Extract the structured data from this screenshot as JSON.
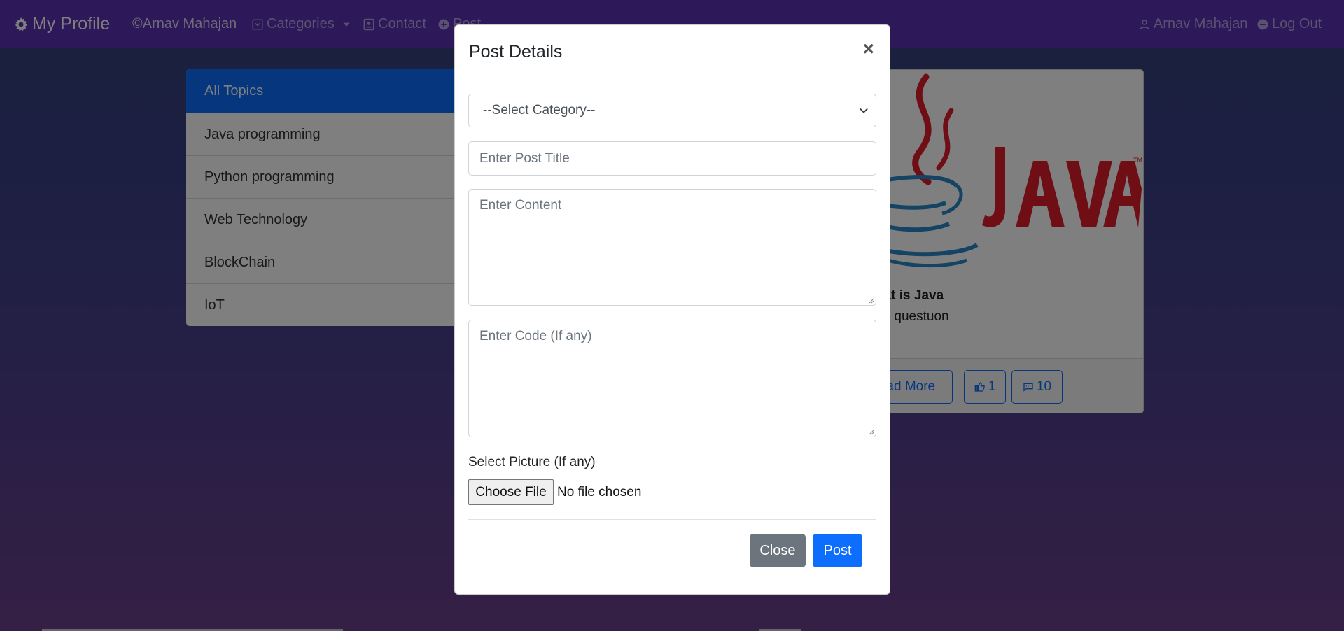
{
  "navbar": {
    "brand": "My Profile",
    "user_link": "©Arnav Mahajan",
    "categories": "Categories",
    "contact": "Contact",
    "post": "Post",
    "profile": "Arnav Mahajan",
    "logout": "Log Out",
    "bg_color": "#5a30b5"
  },
  "categories": [
    "All Topics",
    "Java programming",
    "Python programming",
    "Web Technology",
    "BlockChain",
    "IoT"
  ],
  "post_card": {
    "title": "hat is Java",
    "text": "ob questuon",
    "read_more": "ead More",
    "likes": "1",
    "comments": "10"
  },
  "modal": {
    "title": "Post Details",
    "close_symbol": "×",
    "category_select": "--Select Category--",
    "title_placeholder": "Enter Post Title",
    "content_placeholder": "Enter Content",
    "code_placeholder": "Enter Code (If any)",
    "picture_label": "Select Picture (If any)",
    "file_button": "Choose File",
    "file_status": "No file chosen",
    "close_button": "Close",
    "post_button": "Post"
  },
  "colors": {
    "primary": "#0d6efd",
    "secondary": "#6c757d",
    "java_red": "#e11d2a",
    "java_blue": "#2a86c8"
  }
}
